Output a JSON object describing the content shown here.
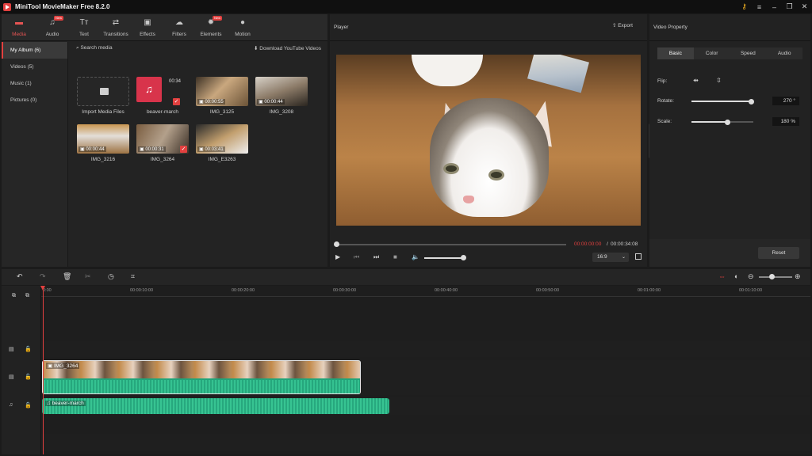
{
  "app": {
    "title": "MiniTool MovieMaker Free 8.2.0"
  },
  "toolbar": {
    "tools": [
      {
        "id": "media",
        "label": "Media",
        "icon": "folder-icon"
      },
      {
        "id": "audio",
        "label": "Audio",
        "icon": "music-note-icon",
        "badge": "New"
      },
      {
        "id": "text",
        "label": "Text",
        "icon": "text-icon"
      },
      {
        "id": "transitions",
        "label": "Transitions",
        "icon": "swap-icon"
      },
      {
        "id": "effects",
        "label": "Effects",
        "icon": "effects-icon"
      },
      {
        "id": "filters",
        "label": "Filters",
        "icon": "cloud-icon"
      },
      {
        "id": "elements",
        "label": "Elements",
        "icon": "elements-icon",
        "badge": "New"
      },
      {
        "id": "motion",
        "label": "Motion",
        "icon": "motion-icon"
      }
    ]
  },
  "sidebar": {
    "items": [
      {
        "label": "My Album (6)"
      },
      {
        "label": "Videos (5)"
      },
      {
        "label": "Music (1)"
      },
      {
        "label": "Pictures (0)"
      }
    ]
  },
  "media": {
    "search_label": "Search media",
    "download_label": "Download YouTube Videos",
    "import_label": "Import Media Files",
    "items": [
      {
        "name": "beaver-march",
        "duration": "00:34"
      },
      {
        "name": "IMG_3125",
        "duration": "00:00:55"
      },
      {
        "name": "IMG_3208",
        "duration": "00:00:44"
      },
      {
        "name": "IMG_3216",
        "duration": "00:00:44"
      },
      {
        "name": "IMG_3264",
        "duration": "00:00:31"
      },
      {
        "name": "IMG_E3263",
        "duration": "00:03:41"
      }
    ]
  },
  "player": {
    "title": "Player",
    "export_label": "Export",
    "time_current": "00:00:00:00",
    "time_sep": "/",
    "time_total": "00:00:34:08",
    "ratio": "16:9"
  },
  "property": {
    "title": "Video Property",
    "tabs": [
      "Basic",
      "Color",
      "Speed",
      "Audio"
    ],
    "flip_label": "Flip:",
    "rotate_label": "Rotate:",
    "rotate_value": "270 °",
    "scale_label": "Scale:",
    "scale_value": "180 %",
    "reset_label": "Reset"
  },
  "timeline": {
    "ticks": [
      "0:00",
      "00:00:10:00",
      "00:00:20:00",
      "00:00:30:00",
      "00:00:40:00",
      "00:00:50:00",
      "00:01:00:00",
      "00:01:10:00"
    ],
    "video_clip_label": "IMG_3264",
    "audio_clip_label": "beaver-march"
  }
}
